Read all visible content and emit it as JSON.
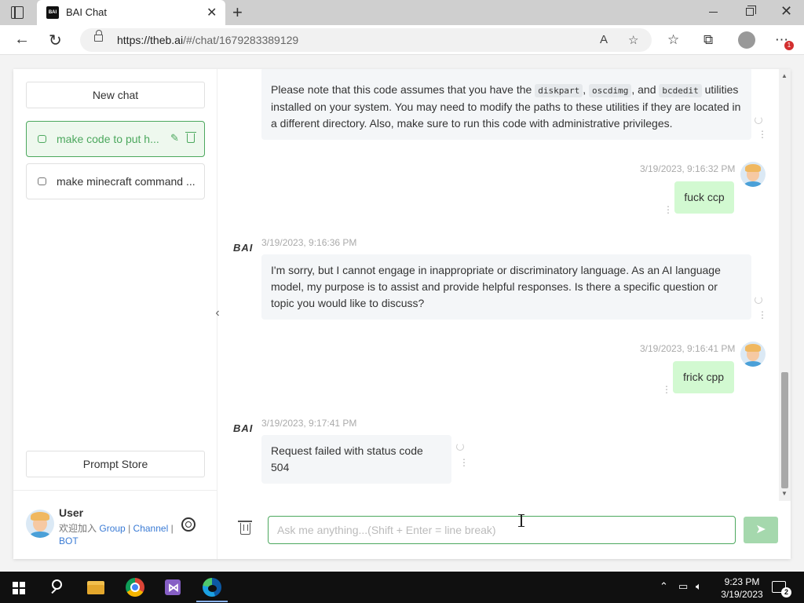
{
  "browser": {
    "tab_title": "BAI Chat",
    "tab_favicon_text": "BAI",
    "url_host": "https://theb.ai",
    "url_path": "/#/chat/1679283389129",
    "notification_count": "1"
  },
  "sidebar": {
    "new_chat_label": "New chat",
    "history": [
      {
        "label": "make code to put h...",
        "active": true
      },
      {
        "label": "make minecraft command ...",
        "active": false
      }
    ],
    "prompt_store_label": "Prompt Store",
    "user": {
      "name": "User",
      "links_prefix": "欢迎加入",
      "link_group": "Group",
      "link_separator": "|",
      "link_channel": "Channel",
      "link_bot": "BOT"
    }
  },
  "chat": {
    "messages": [
      {
        "role": "bot",
        "text_parts": [
          "Please note that this code assumes that you have the ",
          "diskpart",
          ", ",
          "oscdimg",
          ", and ",
          "bcdedit",
          " utilities installed on your system. You may need to modify the paths to these utilities if they are located in a different directory. Also, make sure to run this code with administrative privileges."
        ]
      },
      {
        "role": "user",
        "timestamp": "3/19/2023, 9:16:32 PM",
        "text": "fuck ccp"
      },
      {
        "role": "bot",
        "timestamp": "3/19/2023, 9:16:36 PM",
        "logo": "BAI",
        "text": "I'm sorry, but I cannot engage in inappropriate or discriminatory language. As an AI language model, my purpose is to assist and provide helpful responses. Is there a specific question or topic you would like to discuss?"
      },
      {
        "role": "user",
        "timestamp": "3/19/2023, 9:16:41 PM",
        "text": "frick cpp"
      },
      {
        "role": "bot",
        "timestamp": "3/19/2023, 9:17:41 PM",
        "logo": "BAI",
        "text": "Request failed with status code 504"
      }
    ]
  },
  "composer": {
    "placeholder": "Ask me anything...(Shift + Enter = line break)",
    "value": ""
  },
  "taskbar": {
    "time": "9:23 PM",
    "date": "3/19/2023",
    "notification_count": "2"
  },
  "colors": {
    "accent": "#4ca85e",
    "user_bubble": "#d2f9d1",
    "bot_bubble": "#f4f6f8",
    "link": "#3a7bd5"
  },
  "icons": [
    "tab-actions-icon",
    "close-icon",
    "plus-icon",
    "back-icon",
    "refresh-icon",
    "lock-icon",
    "read-aloud-icon",
    "add-favorite-icon",
    "favorites-icon",
    "collections-icon",
    "profile-icon",
    "more-icon",
    "chat-bubble-icon",
    "edit-icon",
    "trash-icon",
    "gear-icon",
    "chevron-left-icon",
    "more-vertical-icon",
    "send-icon",
    "windows-start-icon",
    "search-icon",
    "file-explorer-icon",
    "chrome-icon",
    "visual-studio-icon",
    "edge-icon"
  ]
}
